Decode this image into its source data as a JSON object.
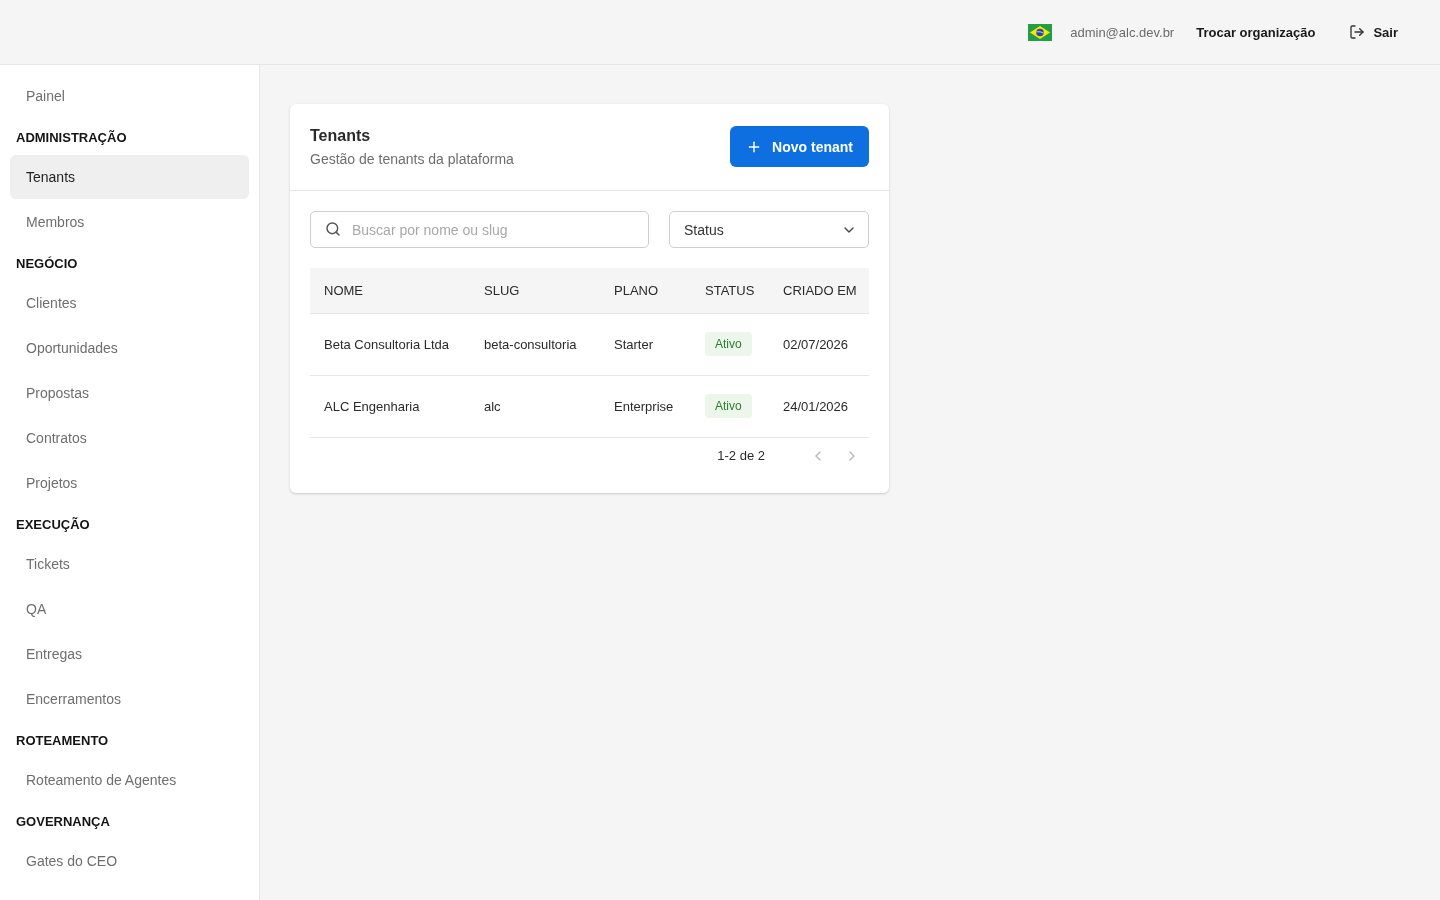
{
  "topbar": {
    "user_email": "admin@alc.dev.br",
    "switch_org": "Trocar organização",
    "logout": "Sair"
  },
  "sidebar": {
    "sections": [
      {
        "items": [
          {
            "label": "Painel",
            "selected": false
          }
        ]
      },
      {
        "title": "ADMINISTRAÇÃO",
        "items": [
          {
            "label": "Tenants",
            "selected": true
          },
          {
            "label": "Membros",
            "selected": false
          }
        ]
      },
      {
        "title": "NEGÓCIO",
        "items": [
          {
            "label": "Clientes",
            "selected": false
          },
          {
            "label": "Oportunidades",
            "selected": false
          },
          {
            "label": "Propostas",
            "selected": false
          },
          {
            "label": "Contratos",
            "selected": false
          },
          {
            "label": "Projetos",
            "selected": false
          }
        ]
      },
      {
        "title": "EXECUÇÃO",
        "items": [
          {
            "label": "Tickets",
            "selected": false
          },
          {
            "label": "QA",
            "selected": false
          },
          {
            "label": "Entregas",
            "selected": false
          },
          {
            "label": "Encerramentos",
            "selected": false
          }
        ]
      },
      {
        "title": "ROTEAMENTO",
        "items": [
          {
            "label": "Roteamento de Agentes",
            "selected": false
          }
        ]
      },
      {
        "title": "GOVERNANÇA",
        "items": [
          {
            "label": "Gates do CEO",
            "selected": false
          }
        ]
      }
    ]
  },
  "card": {
    "title": "Tenants",
    "subtitle": "Gestão de tenants da plataforma",
    "new_button": "Novo tenant",
    "search": {
      "placeholder": "Buscar por nome ou slug"
    },
    "status_filter": {
      "label": "Status"
    },
    "table": {
      "columns": [
        "NOME",
        "SLUG",
        "PLANO",
        "STATUS",
        "CRIADO EM"
      ],
      "rows": [
        {
          "name": "Beta Consultoria Ltda",
          "slug": "beta-consultoria",
          "plan": "Starter",
          "status": {
            "label": "Ativo",
            "kind": "active"
          },
          "created": "02/07/2026"
        },
        {
          "name": "ALC Engenharia",
          "slug": "alc",
          "plan": "Enterprise",
          "status": {
            "label": "Ativo",
            "kind": "active"
          },
          "created": "24/01/2026"
        }
      ]
    },
    "pagination": {
      "range": "1-2 de 2",
      "prev": {
        "disabled": true
      },
      "next": {
        "disabled": true
      }
    }
  }
}
